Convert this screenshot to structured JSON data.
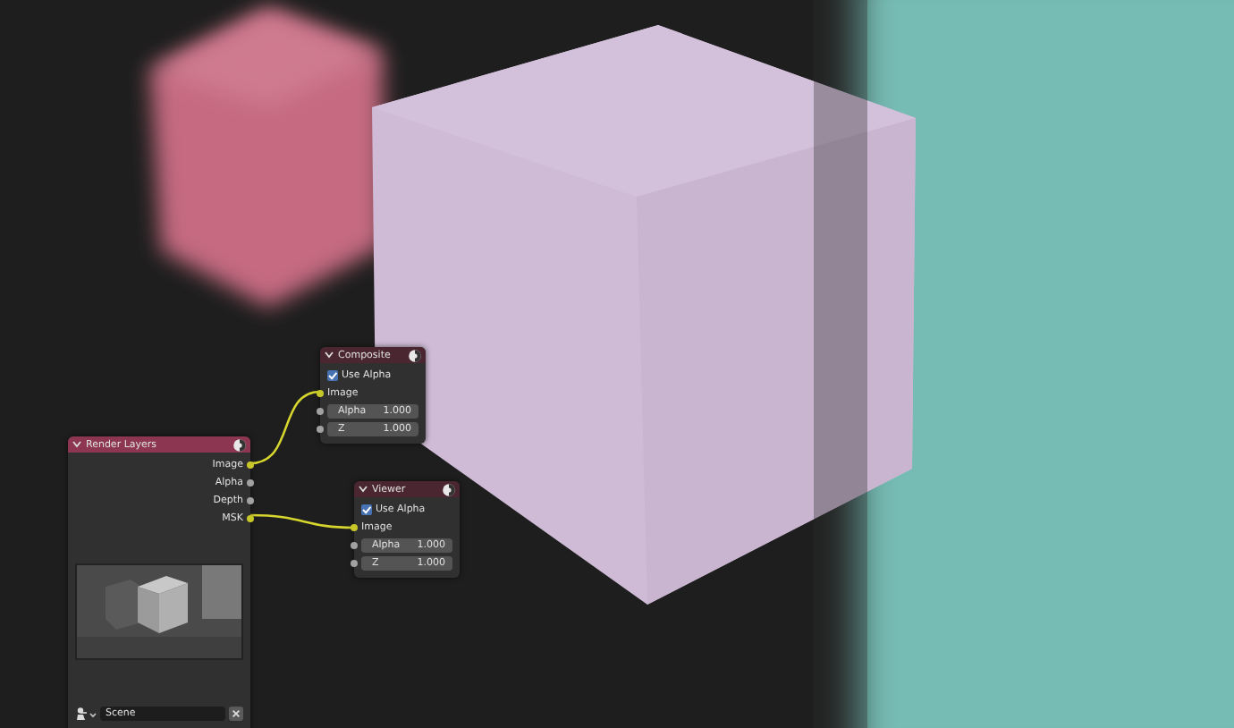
{
  "nodes": [
    {
      "title": "Composite",
      "kind": "output",
      "use_alpha": {
        "label": "Use Alpha",
        "checked": true
      },
      "inputs": [
        {
          "label": "Image",
          "kind": "socket",
          "color": "#c7c729"
        },
        {
          "label": "Alpha",
          "kind": "value",
          "value": "1.000",
          "color": "#a1a1a1"
        },
        {
          "label": "Z",
          "kind": "value",
          "value": "1.000",
          "color": "#a1a1a1"
        }
      ]
    },
    {
      "title": "Render Layers",
      "kind": "source",
      "outputs": [
        {
          "label": "Image",
          "color": "#c7c729"
        },
        {
          "label": "Alpha",
          "color": "#a1a1a1"
        },
        {
          "label": "Depth",
          "color": "#a1a1a1"
        },
        {
          "label": "MSK",
          "color": "#c7c729"
        }
      ],
      "scene": "Scene"
    },
    {
      "title": "Viewer",
      "kind": "output",
      "use_alpha": {
        "label": "Use Alpha",
        "checked": true
      },
      "inputs": [
        {
          "label": "Image",
          "kind": "socket",
          "color": "#c7c729"
        },
        {
          "label": "Alpha",
          "kind": "value",
          "value": "1.000",
          "color": "#a1a1a1"
        },
        {
          "label": "Z",
          "kind": "value",
          "value": "1.000",
          "color": "#a1a1a1"
        }
      ]
    }
  ]
}
